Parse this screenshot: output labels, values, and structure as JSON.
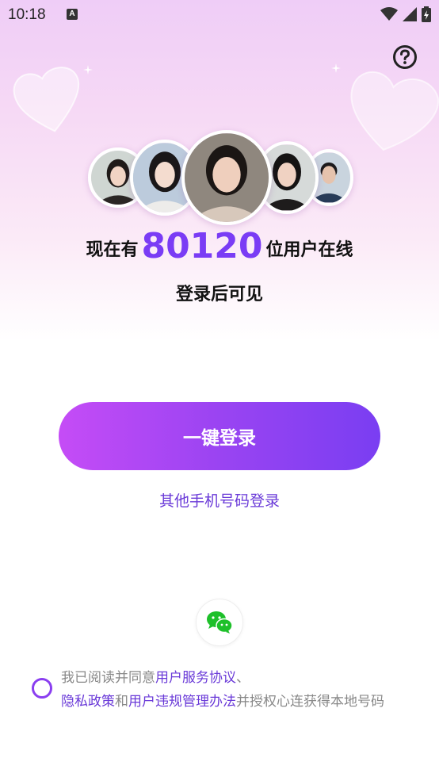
{
  "status_bar": {
    "time": "10:18",
    "notification_icon": "a-letter-icon",
    "icons": [
      "wifi-icon",
      "signal-icon",
      "battery-charging-icon"
    ]
  },
  "header": {
    "help_icon": "question-circle-icon"
  },
  "hero": {
    "avatars": [
      "avatar-1",
      "avatar-2",
      "avatar-3",
      "avatar-4",
      "avatar-5"
    ],
    "online_prefix": "现在有",
    "online_count": "80120",
    "online_suffix": "位用户在线",
    "subtitle": "登录后可见"
  },
  "login": {
    "one_click_label": "一键登录",
    "other_phone_label": "其他手机号码登录",
    "wechat_icon": "wechat-icon"
  },
  "agreement": {
    "prefix": "我已阅读并同意",
    "service_link": "用户服务协议",
    "sep": "、",
    "privacy_link": "隐私政策",
    "and": "和",
    "rules_link": "用户违规管理办法",
    "suffix": "并授权心连获得本地号码"
  },
  "colors": {
    "accent": "#7a3cf5",
    "button_gradient_start": "#c54cf6",
    "button_gradient_end": "#7a3ef2"
  }
}
